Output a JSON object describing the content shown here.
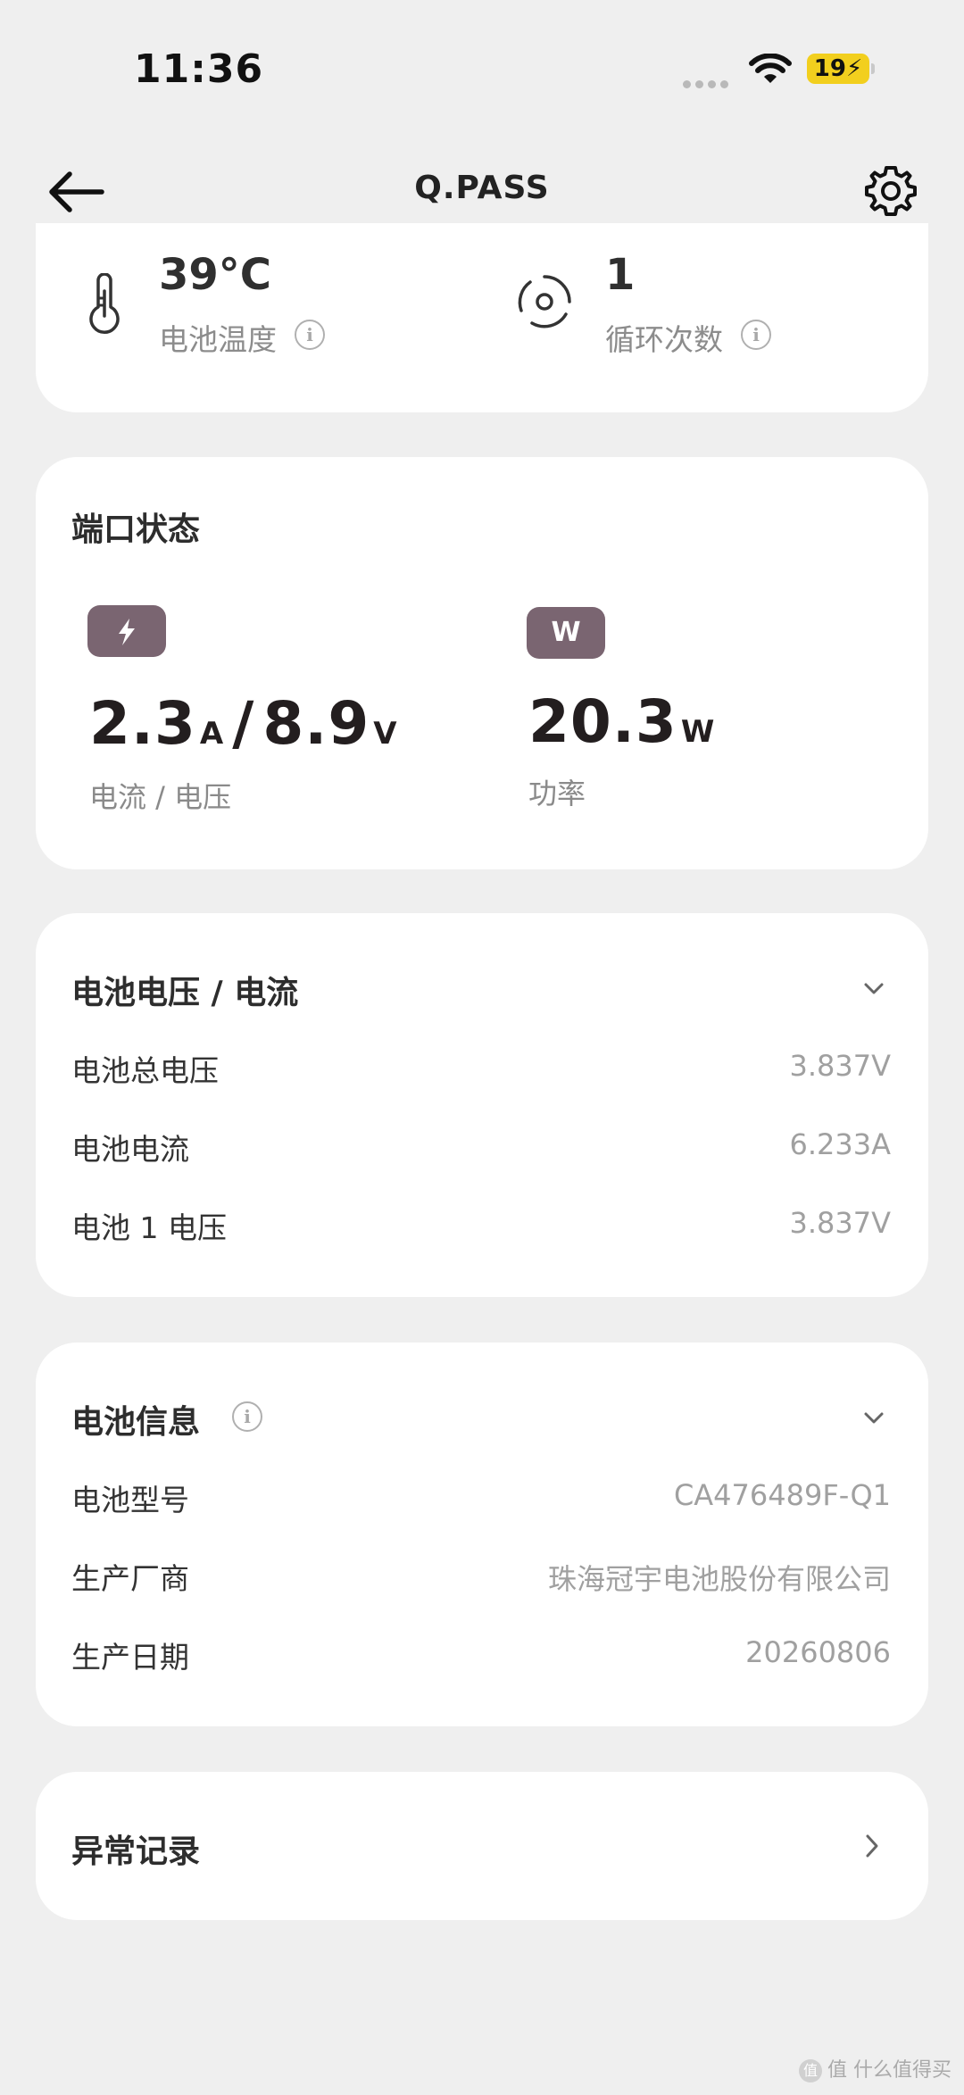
{
  "status_bar": {
    "time": "11:36",
    "battery_level": "19"
  },
  "nav": {
    "title": "Q.PASS"
  },
  "battery_stats": {
    "temperature": {
      "value": "39°C",
      "label": "电池温度"
    },
    "cycles": {
      "value": "1",
      "label": "循环次数"
    }
  },
  "port_status": {
    "title": "端口状态",
    "current_value": "2.3",
    "current_unit": "A",
    "separator": "/",
    "voltage_value": "8.9",
    "voltage_unit": "V",
    "current_voltage_label": "电流 / 电压",
    "power_badge": "W",
    "power_value": "20.3",
    "power_unit": "W",
    "power_label": "功率"
  },
  "voltage_section": {
    "title": "电池电压 / 电流",
    "rows": [
      {
        "label": "电池总电压",
        "value": "3.837V"
      },
      {
        "label": "电池电流",
        "value": "6.233A"
      },
      {
        "label": "电池 1 电压",
        "value": "3.837V"
      }
    ]
  },
  "battery_info": {
    "title": "电池信息",
    "rows": [
      {
        "label": "电池型号",
        "value": "CA476489F-Q1"
      },
      {
        "label": "生产厂商",
        "value": "珠海冠宇电池股份有限公司"
      },
      {
        "label": "生产日期",
        "value": "20260806"
      }
    ]
  },
  "abnormal": {
    "title": "异常记录"
  },
  "watermark": {
    "text": "值 什么值得买"
  },
  "colors": {
    "badge": "#7a6571",
    "battery": "#f2cf1e",
    "background": "#efefef"
  }
}
